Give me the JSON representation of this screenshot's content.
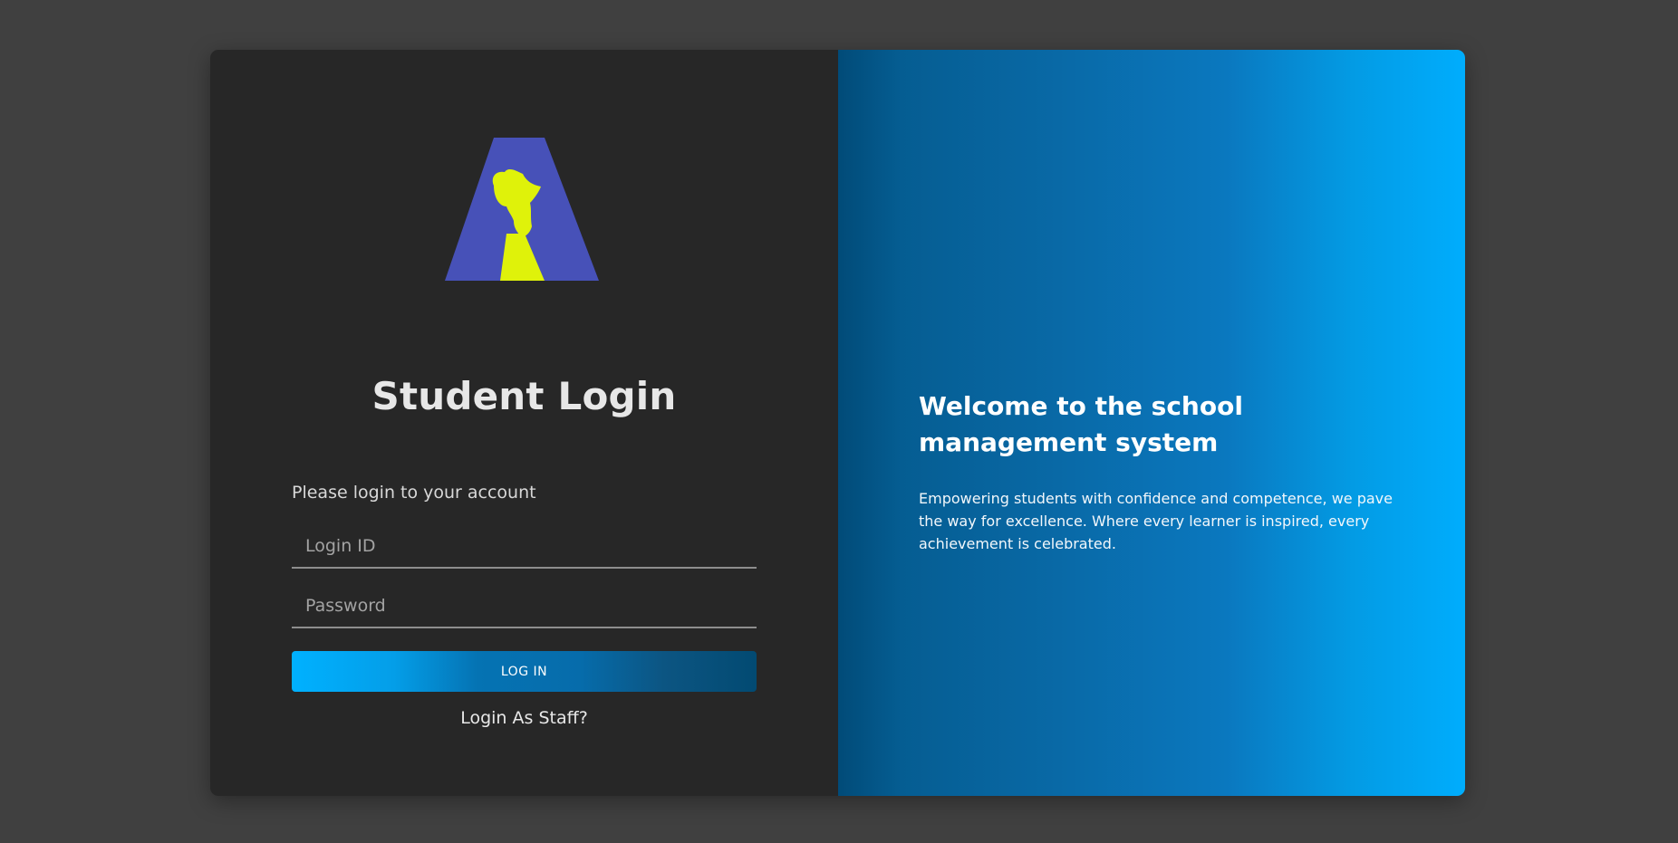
{
  "login_panel": {
    "title": "Student Login",
    "subtitle": "Please login to your account",
    "login_id": {
      "value": "",
      "placeholder": "Login ID"
    },
    "password": {
      "value": "",
      "placeholder": "Password"
    },
    "login_button_label": "LOG IN",
    "staff_link_label": "Login As Staff?"
  },
  "logo": {
    "icon": "school-logo-africa-torch",
    "triangle_color": "#4751b8",
    "emblem_color": "#dff20a"
  },
  "info_panel": {
    "heading": "Welcome to the school management system",
    "description": "Empowering students with confidence and competence, we pave the way for excellence. Where every learner is inspired, every achievement is celebrated."
  },
  "colors": {
    "page_background": "#404040",
    "panel_dark": "#272727",
    "accent_blue": "#00adfd",
    "deep_blue": "#014b78"
  }
}
